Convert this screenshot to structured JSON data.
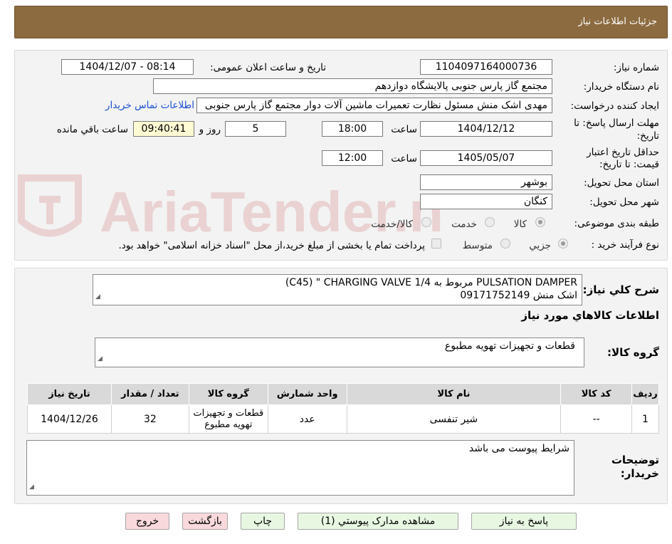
{
  "header": {
    "title": "جزئیات اطلاعات نیاز"
  },
  "watermark": {
    "text": "AriaTender.neT"
  },
  "info": {
    "need_number_label": "شماره نیاز:",
    "need_number": "1104097164000736",
    "announce_label": "تاریخ و ساعت اعلان عمومی:",
    "announce_value": "1404/12/07 - 08:14",
    "buyer_label": "نام دستگاه خریدار:",
    "buyer_value": "مجتمع گاز پارس جنوبی  پالایشگاه دوازدهم",
    "creator_label": "ایجاد کننده درخواست:",
    "creator_value": "مهدی اشک منش مسئول نظارت تعمیرات ماشین آلات دوار مجتمع گاز پارس جنوبی",
    "contact_link": "اطلاعات تماس خریدار",
    "deadline_label_1": "مهلت ارسال پاسخ: تا",
    "deadline_label_2": "تاریخ:",
    "deadline_date": "1404/12/12",
    "time_label": "ساعت",
    "deadline_time": "18:00",
    "days_value": "5",
    "days_and_label": "روز و",
    "remaining_time": "09:40:41",
    "remaining_label": "ساعت باقي مانده",
    "validity_label_1": "حداقل تاریخ اعتبار",
    "validity_label_2": "قیمت: تا تاریخ:",
    "validity_date": "1405/05/07",
    "validity_time": "12:00",
    "province_label": "استان محل تحویل:",
    "province_value": "بوشهر",
    "city_label": "شهر محل تحویل:",
    "city_value": "کنگان",
    "category_label": "طبقه بندی موضوعی:",
    "category_options": [
      "کالا",
      "خدمت",
      "کالا/خدمت"
    ],
    "process_label": "نوع فرآیند خرید :",
    "process_options": [
      "جزیي",
      "متوسط"
    ],
    "payment_note": "پرداخت تمام یا بخشی از مبلغ خرید،از محل \"اسناد خزانه اسلامی\" خواهد بود."
  },
  "description": {
    "label": "شرح کلي نياز:",
    "line1": "(C45) \" CHARGING VALVE 1/4 مربوط به PULSATION DAMPER",
    "line2": "اشک منش 09171752149"
  },
  "goods": {
    "section_title": "اطلاعات کالاهاي مورد نياز",
    "group_label": "گروه کالا:",
    "group_value": "قطعات و تجهیزات تهویه مطبوع",
    "columns": [
      "ردیف",
      "کد کالا",
      "نام کالا",
      "واحد شمارش",
      "گروه کالا",
      "تعداد / مقدار",
      "تاریخ نیاز"
    ],
    "rows": [
      [
        "1",
        "--",
        "شیر تنفسی",
        "عدد",
        "قطعات و تجهیزات تهویه مطبوع",
        "32",
        "1404/12/26"
      ]
    ]
  },
  "buyer_notes": {
    "label_1": "توضیحات",
    "label_2": "خریدار:",
    "value": "شرایط پیوست می باشد"
  },
  "buttons": {
    "reply": "پاسخ به نیاز",
    "attachments": "مشاهده مدارک پیوستي (1)",
    "print": "چاپ",
    "back": "بازگشت",
    "exit": "خروج"
  }
}
